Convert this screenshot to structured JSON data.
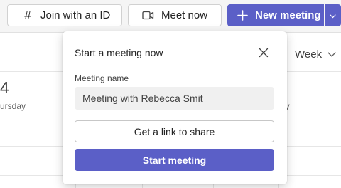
{
  "toolbar": {
    "join_label": "Join with an ID",
    "join_icon": "hash-icon",
    "meet_label": "Meet now",
    "meet_icon": "video-camera-icon",
    "new_meeting_label": "New meeting",
    "new_meeting_icon": "plus-icon",
    "dropdown_icon": "chevron-down-icon"
  },
  "calendar": {
    "view_label": "Week",
    "day_number": "4",
    "day_name": "ursday",
    "right_day_name": "ay"
  },
  "popup": {
    "title": "Start a meeting now",
    "close_icon": "close-icon",
    "field_label": "Meeting name",
    "meeting_name_value": "Meeting with Rebecca Smit",
    "link_button_label": "Get a link to share",
    "start_button_label": "Start meeting"
  },
  "colors": {
    "accent": "#5b5fc7",
    "background": "#f5f5f5",
    "surface": "#ffffff"
  }
}
